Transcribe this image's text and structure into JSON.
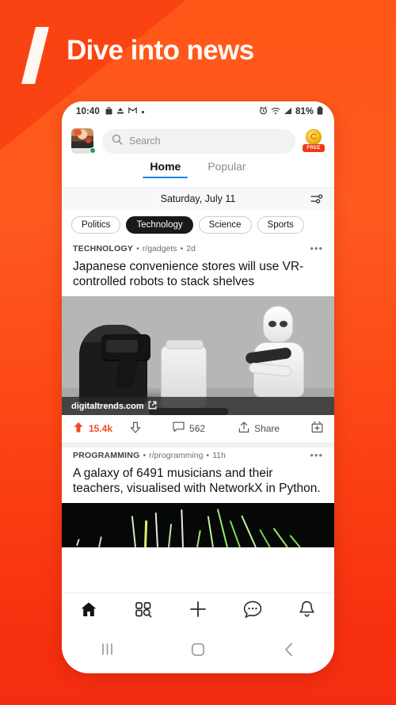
{
  "promo": {
    "headline": "Dive into news",
    "slash_icon": "slash-mark"
  },
  "statusbar": {
    "time": "10:40",
    "left_icons": [
      "bag-icon",
      "inbox-icon",
      "gmail-icon",
      "dot-icon"
    ],
    "right_icons": [
      "alarm-icon",
      "wifi-icon",
      "signal-icon"
    ],
    "battery_text": "81%",
    "battery_icon": "battery-icon"
  },
  "header": {
    "avatar_name": "user-avatar",
    "online_status": "online",
    "search": {
      "placeholder": "Search",
      "icon": "search-icon"
    },
    "coin": {
      "symbol": "C",
      "label": "FREE"
    }
  },
  "tabs": [
    {
      "label": "Home",
      "active": true
    },
    {
      "label": "Popular",
      "active": false
    }
  ],
  "daterow": {
    "date": "Saturday, July 11",
    "filter_icon": "sliders-icon"
  },
  "chips": [
    {
      "label": "Politics",
      "active": false
    },
    {
      "label": "Technology",
      "active": true
    },
    {
      "label": "Science",
      "active": false
    },
    {
      "label": "Sports",
      "active": false
    }
  ],
  "posts": [
    {
      "category": "TECHNOLOGY",
      "subreddit": "r/gadgets",
      "age": "2d",
      "separator": "•",
      "title": "Japanese convenience stores will use VR-controlled robots to stack shelves",
      "source": "digitaltrends.com",
      "source_icon": "external-link-icon",
      "upvote_icon": "upvote-arrow-icon",
      "upvotes": "15.4k",
      "downvote_icon": "downvote-arrow-icon",
      "comment_icon": "comment-bubble-icon",
      "comments": "562",
      "share_icon": "share-icon",
      "share_label": "Share",
      "award_icon": "award-gift-icon",
      "more_icon": "more-dots-icon"
    },
    {
      "category": "PROGRAMMING",
      "subreddit": "r/programming",
      "age": "11h",
      "separator": "•",
      "title": "A galaxy of 6491 musicians and their teachers, visualised with NetworkX in Python.",
      "more_icon": "more-dots-icon"
    }
  ],
  "bottomnav": [
    {
      "name": "home",
      "icon": "home-icon",
      "active": true
    },
    {
      "name": "discover",
      "icon": "grid-search-icon",
      "active": false
    },
    {
      "name": "create",
      "icon": "plus-icon",
      "active": false
    },
    {
      "name": "chat",
      "icon": "chat-bubble-icon",
      "active": false
    },
    {
      "name": "notifications",
      "icon": "bell-icon",
      "active": false
    }
  ],
  "sysnav": [
    {
      "name": "recents",
      "icon": "recents-icon"
    },
    {
      "name": "home",
      "icon": "home-square-icon"
    },
    {
      "name": "back",
      "icon": "back-chevron-icon"
    }
  ],
  "colors": {
    "brand_orange": "#FF5A1F",
    "brand_red": "#F42D10",
    "accent_blue": "#1884F7",
    "upvote": "#F04B20",
    "chip_active": "#18191A"
  }
}
